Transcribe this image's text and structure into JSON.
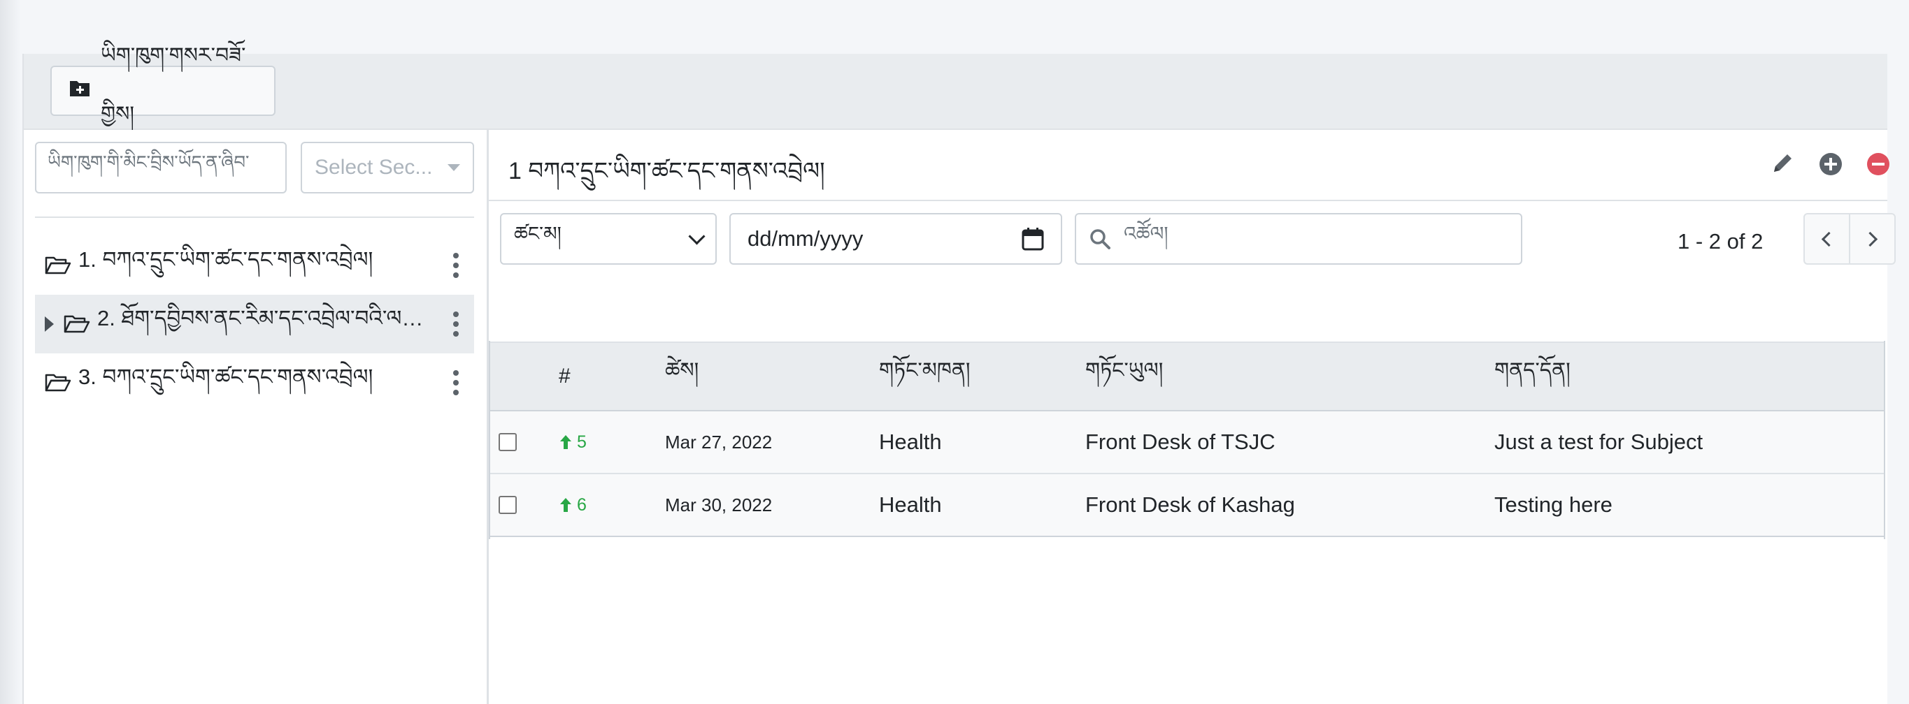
{
  "toolbar": {
    "new_folder_label": "ཡིག་ཁུག་གསར་བཟོ་གྱིས།"
  },
  "sidebar": {
    "search_placeholder": "ཡིག་ཁུག་གི་མིང་བྲིས་ཡོད་ན་ཞིབ་",
    "section_select": "Select Sec...",
    "items": [
      {
        "label": "1. བཀའ་དྲུང་ཡིག་ཚང་དང་གནས་འབྲེལ།",
        "expandable": false,
        "active": false
      },
      {
        "label": "2. ཐོག་དབྱིབས་ནང་རིམ་དང་འབྲེལ་བའི་ལས་...",
        "expandable": true,
        "active": true
      },
      {
        "label": "3. བཀའ་དྲུང་ཡིག་ཚང་དང་གནས་འབྲེལ།",
        "expandable": false,
        "active": false
      }
    ]
  },
  "content": {
    "title": "1 བཀའ་དྲུང་ཡིག་ཚང་དང་གནས་འབྲེལ།",
    "filters": {
      "status_value": "ཚང་མ།",
      "date_placeholder": "dd/mm/yyyy",
      "search_placeholder": "འཚོལ།"
    },
    "pagination": {
      "text": "1 - 2 of 2"
    },
    "table": {
      "headers": [
        "#",
        "ཚེས།",
        "གཏོང་མཁན།",
        "གཏོང་ཡུལ།",
        "གནད་དོན།"
      ],
      "rows": [
        {
          "num": "5",
          "date": "Mar 27, 2022",
          "sender": "Health",
          "recipient": "Front Desk of TSJC",
          "subject": "Just a test for Subject"
        },
        {
          "num": "6",
          "date": "Mar 30, 2022",
          "sender": "Health",
          "recipient": "Front Desk of Kashag",
          "subject": "Testing here"
        }
      ]
    }
  },
  "colors": {
    "accent_green": "#28a745",
    "danger_red": "#e0505e",
    "header_bg": "#e9ecef"
  }
}
